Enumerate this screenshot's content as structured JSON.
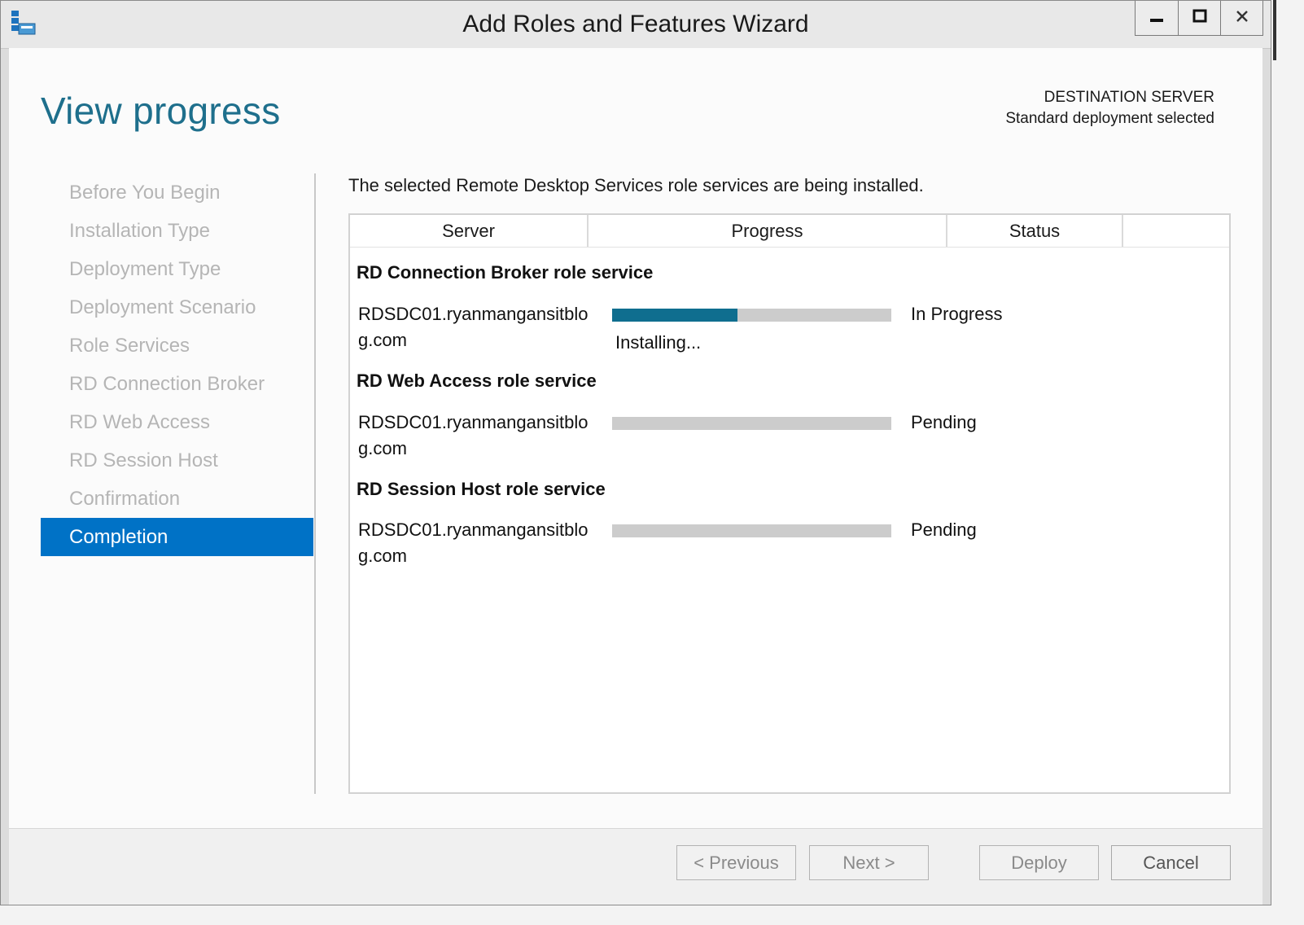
{
  "window": {
    "title": "Add Roles and Features Wizard",
    "controls": [
      "minimize",
      "maximize",
      "close"
    ]
  },
  "header": {
    "page_title": "View progress",
    "destination_label": "DESTINATION SERVER",
    "destination_value": "Standard deployment selected"
  },
  "nav": {
    "items": [
      {
        "label": "Before You Begin",
        "active": false
      },
      {
        "label": "Installation Type",
        "active": false
      },
      {
        "label": "Deployment Type",
        "active": false
      },
      {
        "label": "Deployment Scenario",
        "active": false
      },
      {
        "label": "Role Services",
        "active": false
      },
      {
        "label": "RD Connection Broker",
        "active": false
      },
      {
        "label": "RD Web Access",
        "active": false
      },
      {
        "label": "RD Session Host",
        "active": false
      },
      {
        "label": "Confirmation",
        "active": false
      },
      {
        "label": "Completion",
        "active": true
      }
    ]
  },
  "main": {
    "intro": "The selected Remote Desktop Services role services are being installed.",
    "columns": [
      "Server",
      "Progress",
      "Status",
      ""
    ],
    "groups": [
      {
        "title": "RD Connection Broker role service",
        "server": "RDSDC01.ryanmangansitblog.com",
        "progress": 0.45,
        "substatus": "Installing...",
        "status": "In Progress"
      },
      {
        "title": "RD Web Access role service",
        "server": "RDSDC01.ryanmangansitblog.com",
        "progress": 0,
        "substatus": "",
        "status": "Pending"
      },
      {
        "title": "RD Session Host role service",
        "server": "RDSDC01.ryanmangansitblog.com",
        "progress": 0,
        "substatus": "",
        "status": "Pending"
      }
    ]
  },
  "footer": {
    "previous_label": "< Previous",
    "next_label": "Next >",
    "deploy_label": "Deploy",
    "cancel_label": "Cancel"
  },
  "colors": {
    "accent": "#0072c6",
    "title_blue": "#1e6f8c",
    "progress_fill": "#0f6e8f",
    "progress_track": "#cccccc",
    "nav_inactive": "#b5b5b5"
  }
}
